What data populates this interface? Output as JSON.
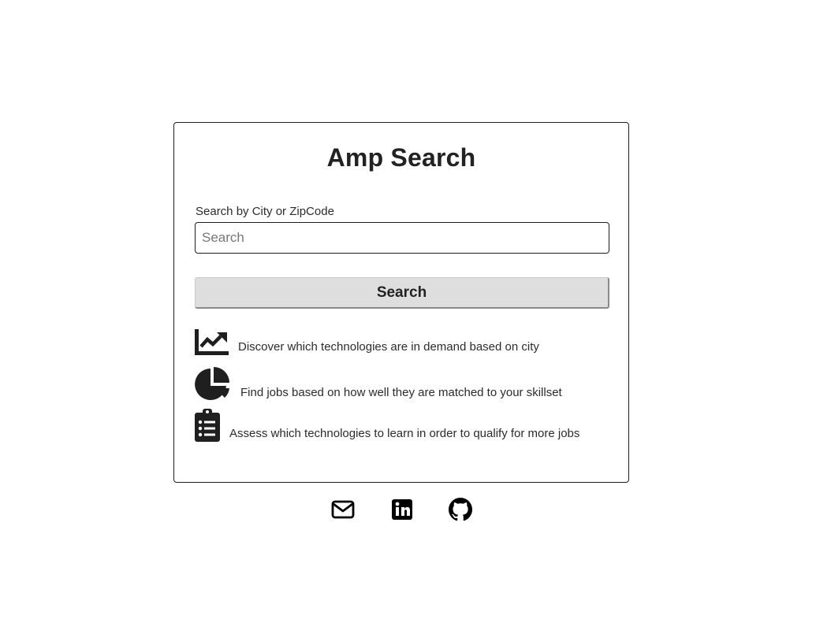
{
  "app": {
    "title": "Amp Search"
  },
  "search": {
    "label": "Search by City or ZipCode",
    "placeholder": "Search",
    "value": "",
    "button_label": "Search"
  },
  "features": [
    {
      "icon": "chart-line-icon",
      "text": "Discover which technologies are in demand based on city"
    },
    {
      "icon": "pie-chart-icon",
      "text": "Find jobs based on how well they are matched to your skillset"
    },
    {
      "icon": "clipboard-list-icon",
      "text": "Assess which technologies to learn in order to qualify for more jobs"
    }
  ],
  "social": [
    {
      "icon": "envelope-icon"
    },
    {
      "icon": "linkedin-icon"
    },
    {
      "icon": "github-icon"
    }
  ],
  "colors": {
    "text": "#222222",
    "border": "#1e1e1e",
    "button_bg": "#dedede",
    "icon": "#1f1f1f"
  }
}
